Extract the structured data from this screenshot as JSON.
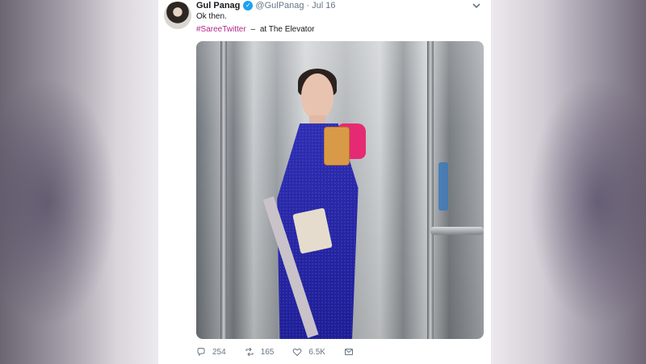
{
  "tweet": {
    "display_name": "Gul Panag",
    "handle": "@GulPanag",
    "separator_dot": "·",
    "date": "Jul 16",
    "text": "Ok then.",
    "hashtag": "#SareeTwitter",
    "location_separator": "–",
    "location": "at The Elevator",
    "photo_icon": "elevator-selfie-image",
    "actions": {
      "replies": "254",
      "retweets": "165",
      "likes": "6.5K"
    },
    "colors": {
      "hashtag": "#b0268a",
      "verified": "#1da1f2",
      "muted_text": "#657786"
    }
  }
}
